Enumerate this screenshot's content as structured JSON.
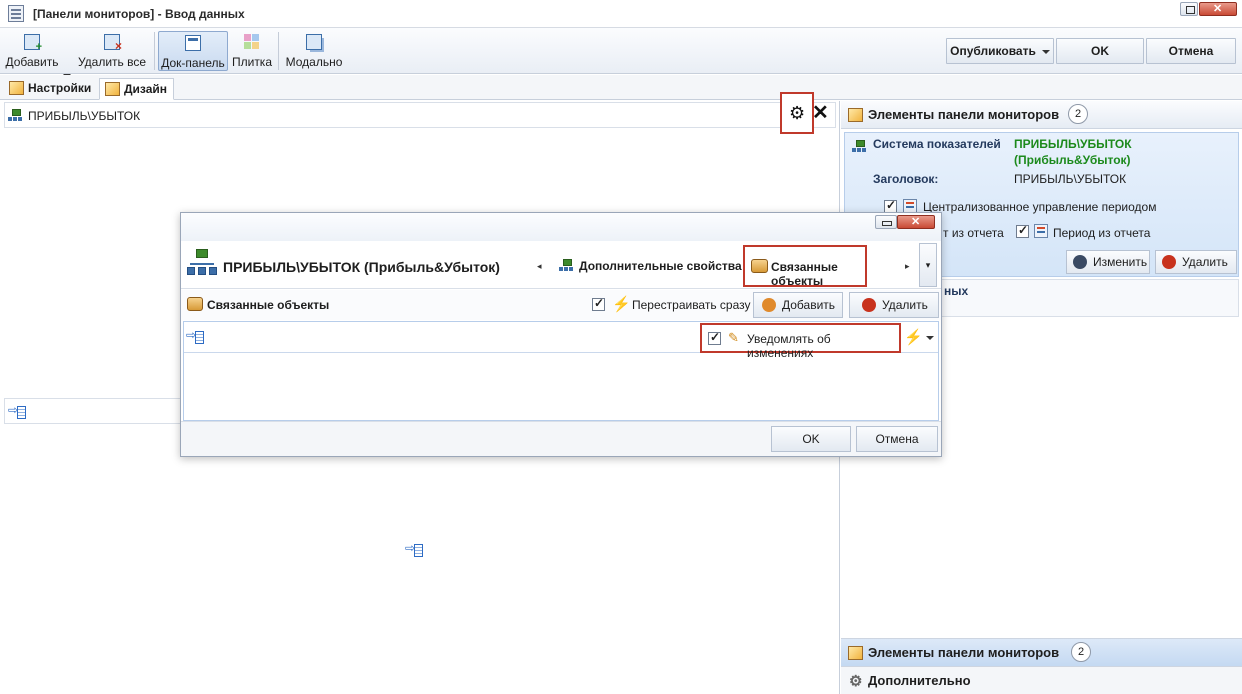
{
  "window": {
    "title": "[Панели мониторов] - Ввод данных"
  },
  "toolbar": {
    "add_label": "Добавить",
    "delete_all_label": "Удалить все",
    "dock_panel_label": "Док-панель",
    "tile_label": "Плитка",
    "modal_label": "Модально",
    "publish_label": "Опубликовать",
    "ok_label": "OK",
    "cancel_label": "Отмена"
  },
  "tabs": [
    {
      "label": "Настройки",
      "active": false
    },
    {
      "label": "Дизайн",
      "active": true
    }
  ],
  "design": {
    "top_item_label": "ПРИБЫЛЬ\\УБЫТОК"
  },
  "right_panel": {
    "header_label": "Элементы панели мониторов",
    "header_count": "2",
    "card": {
      "system_key": "Система показателей",
      "system_value_line1": "ПРИБЫЛЬ\\УБЫТОК",
      "system_value_line2": "(Прибыль&Убыток)",
      "header_key": "Заголовок:",
      "header_value": "ПРИБЫЛЬ\\УБЫТОК",
      "central_period_label": "Централизованное управление периодом",
      "from_report_fragment": "т из отчета",
      "period_from_report_label": "Период из отчета",
      "edit_label": "Изменить",
      "delete_label": "Удалить"
    },
    "card2_fragment": "ных",
    "footer1_label": "Элементы панели мониторов",
    "footer1_count": "2",
    "footer2_label": "Дополнительно"
  },
  "dialog": {
    "object_name": "ПРИБЫЛЬ\\УБЫТОК (Прибыль&Убыток)",
    "nav_additional_label": "Дополнительные свойства",
    "nav_linked_label": "Связанные объекты",
    "section_title": "Связанные объекты",
    "rebuild_label": "Перестраивать сразу",
    "add_label": "Добавить",
    "delete_label": "Удалить",
    "notify_label": "Уведомлять об изменениях",
    "ok_label": "OK",
    "cancel_label": "Отмена"
  },
  "colors": {
    "accent_green": "#1c8a1c",
    "highlight_red": "#c0392b",
    "selection_blue": "#d4e5f8"
  }
}
